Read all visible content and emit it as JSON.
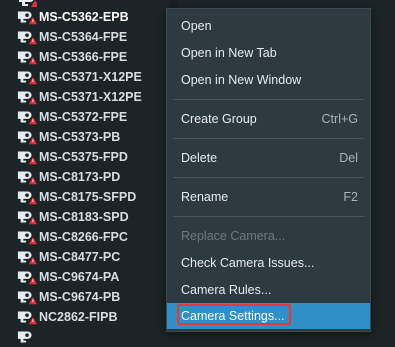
{
  "tree": {
    "items": [
      {
        "label": "MS-C5362-EPB",
        "selected": true
      },
      {
        "label": "MS-C5364-FPE"
      },
      {
        "label": "MS-C5366-FPE"
      },
      {
        "label": "MS-C5371-X12PE"
      },
      {
        "label": "MS-C5371-X12PE"
      },
      {
        "label": "MS-C5372-FPE"
      },
      {
        "label": "MS-C5373-PB"
      },
      {
        "label": "MS-C5375-FPD"
      },
      {
        "label": "MS-C8173-PD"
      },
      {
        "label": "MS-C8175-SFPD"
      },
      {
        "label": "MS-C8183-SPD"
      },
      {
        "label": "MS-C8266-FPC"
      },
      {
        "label": "MS-C8477-PC"
      },
      {
        "label": "MS-C9674-PA"
      },
      {
        "label": "MS-C9674-PB"
      },
      {
        "label": "NC2862-FIPB"
      }
    ],
    "icon": "camera-offline-icon",
    "icon_colors": {
      "camera": "#e8ecee",
      "alert": "#e0303a"
    }
  },
  "context_menu": {
    "items": [
      {
        "label": "Open",
        "shortcut": ""
      },
      {
        "label": "Open in New Tab",
        "shortcut": ""
      },
      {
        "label": "Open in New Window",
        "shortcut": ""
      },
      {
        "label": "Create Group",
        "shortcut": "Ctrl+G"
      },
      {
        "label": "Delete",
        "shortcut": "Del"
      },
      {
        "label": "Rename",
        "shortcut": "F2"
      },
      {
        "label": "Replace Camera...",
        "shortcut": "",
        "disabled": true
      },
      {
        "label": "Check Camera Issues...",
        "shortcut": ""
      },
      {
        "label": "Camera Rules...",
        "shortcut": ""
      },
      {
        "label": "Camera Settings...",
        "shortcut": "",
        "highlighted": true
      }
    ],
    "highlight_color": "#2f8fc6",
    "focus_outline_color": "#e53935"
  }
}
